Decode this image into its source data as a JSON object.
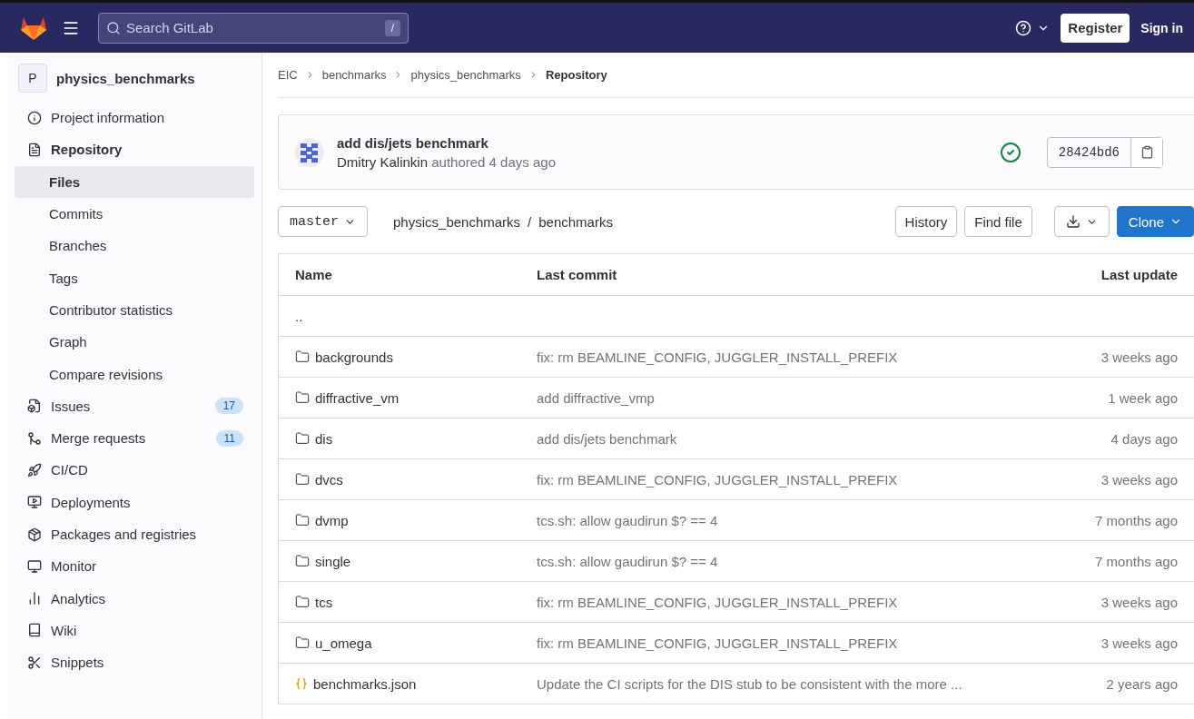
{
  "topbar": {
    "search": {
      "placeholder": "Search GitLab",
      "shortcut": "/"
    },
    "register": "Register",
    "sign_in": "Sign in"
  },
  "sidebar": {
    "project": {
      "avatar": "P",
      "name": "physics_benchmarks"
    },
    "items": [
      {
        "label": "Project information",
        "expanded": false
      },
      {
        "label": "Repository",
        "expanded": true,
        "children": [
          {
            "label": "Files",
            "selected": true
          },
          {
            "label": "Commits",
            "selected": false
          },
          {
            "label": "Branches",
            "selected": false
          },
          {
            "label": "Tags",
            "selected": false
          },
          {
            "label": "Contributor statistics",
            "selected": false
          },
          {
            "label": "Graph",
            "selected": false
          },
          {
            "label": "Compare revisions",
            "selected": false
          }
        ]
      },
      {
        "label": "Issues",
        "count": "17",
        "expanded": false
      },
      {
        "label": "Merge requests",
        "count": "11",
        "expanded": false
      },
      {
        "label": "CI/CD",
        "expanded": false
      },
      {
        "label": "Deployments",
        "expanded": false
      },
      {
        "label": "Packages and registries",
        "expanded": false
      },
      {
        "label": "Monitor",
        "expanded": false
      },
      {
        "label": "Analytics",
        "expanded": false
      },
      {
        "label": "Wiki",
        "expanded": false
      },
      {
        "label": "Snippets",
        "expanded": false
      }
    ]
  },
  "breadcrumbs": [
    {
      "label": "EIC",
      "current": false
    },
    {
      "label": "benchmarks",
      "current": false
    },
    {
      "label": "physics_benchmarks",
      "current": false
    },
    {
      "label": "Repository",
      "current": true
    }
  ],
  "last_commit": {
    "title": "add dis/jets benchmark",
    "author": "Dmitry Kalinkin",
    "meta": "authored 4 days ago",
    "sha": "28424bd6"
  },
  "toolbar": {
    "branch": "master",
    "path": [
      "physics_benchmarks",
      "/",
      "benchmarks"
    ],
    "history": "History",
    "find_file": "Find file",
    "clone": "Clone"
  },
  "table": {
    "columns": [
      "Name",
      "Last commit",
      "Last update"
    ],
    "rows": [
      {
        "kind": "parent",
        "name": ".."
      },
      {
        "kind": "folder",
        "name": "backgrounds",
        "commit": "fix: rm BEAMLINE_CONFIG, JUGGLER_INSTALL_PREFIX",
        "updated": "3 weeks ago"
      },
      {
        "kind": "folder",
        "name": "diffractive_vm",
        "commit": "add diffractive_vmp",
        "updated": "1 week ago"
      },
      {
        "kind": "folder",
        "name": "dis",
        "commit": "add dis/jets benchmark",
        "updated": "4 days ago"
      },
      {
        "kind": "folder",
        "name": "dvcs",
        "commit": "fix: rm BEAMLINE_CONFIG, JUGGLER_INSTALL_PREFIX",
        "updated": "3 weeks ago"
      },
      {
        "kind": "folder",
        "name": "dvmp",
        "commit": "tcs.sh: allow gaudirun $? == 4",
        "updated": "7 months ago"
      },
      {
        "kind": "folder",
        "name": "single",
        "commit": "tcs.sh: allow gaudirun $? == 4",
        "updated": "7 months ago"
      },
      {
        "kind": "folder",
        "name": "tcs",
        "commit": "fix: rm BEAMLINE_CONFIG, JUGGLER_INSTALL_PREFIX",
        "updated": "3 weeks ago"
      },
      {
        "kind": "folder",
        "name": "u_omega",
        "commit": "fix: rm BEAMLINE_CONFIG, JUGGLER_INSTALL_PREFIX",
        "updated": "3 weeks ago"
      },
      {
        "kind": "json",
        "name": "benchmarks.json",
        "commit": "Update the CI scripts for the DIS stub to be consistent with the more ...",
        "updated": "2 years ago"
      }
    ]
  }
}
